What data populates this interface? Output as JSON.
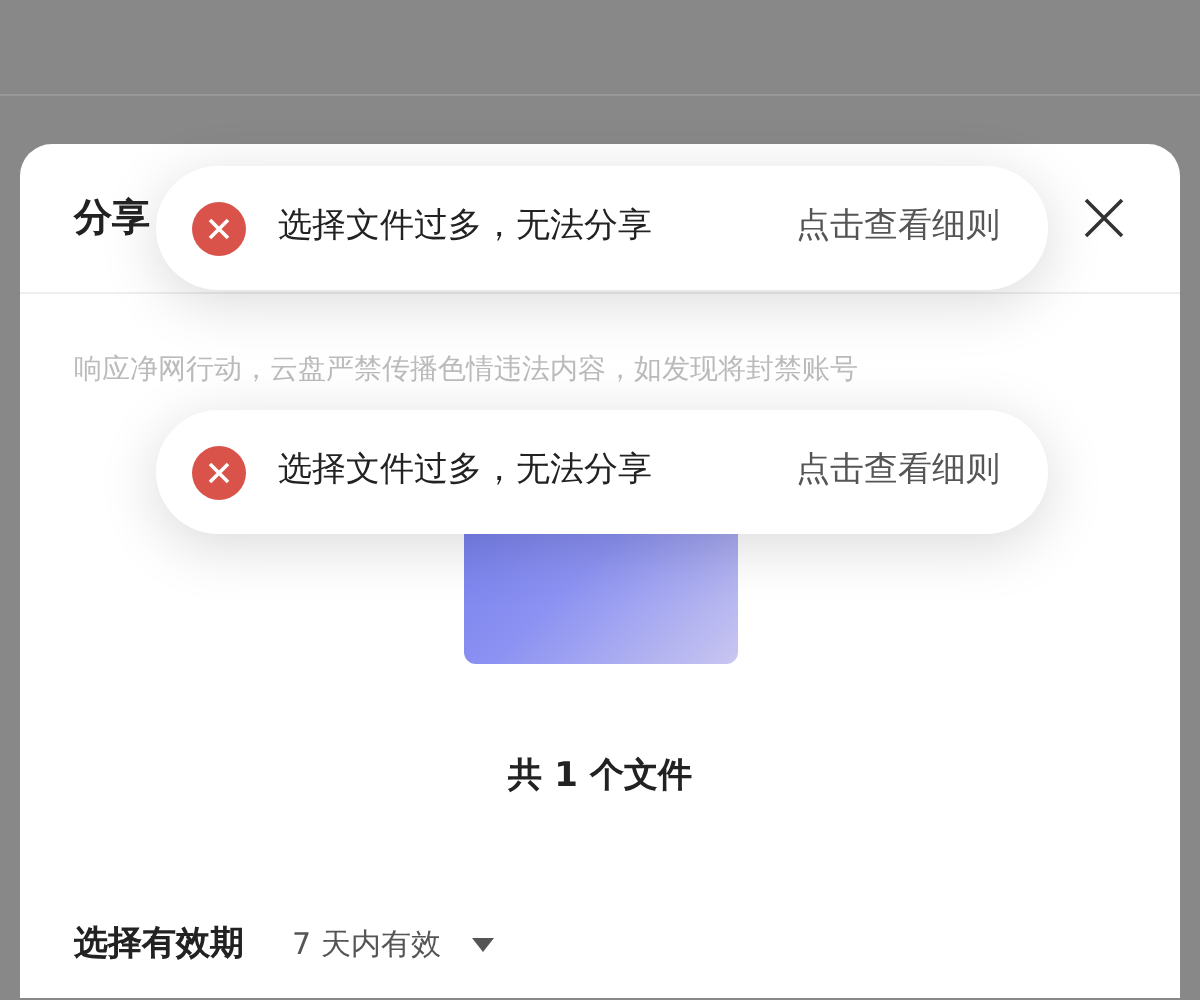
{
  "dialog": {
    "title": "分享",
    "notice": "响应净网行动，云盘严禁传播色情违法内容，如发现将封禁账号",
    "file_count": "共 1 个文件",
    "expiry": {
      "label": "选择有效期",
      "value": "7 天内有效"
    }
  },
  "toasts": [
    {
      "message": "选择文件过多，无法分享",
      "action": "点击查看细则"
    },
    {
      "message": "选择文件过多，无法分享",
      "action": "点击查看细则"
    }
  ]
}
